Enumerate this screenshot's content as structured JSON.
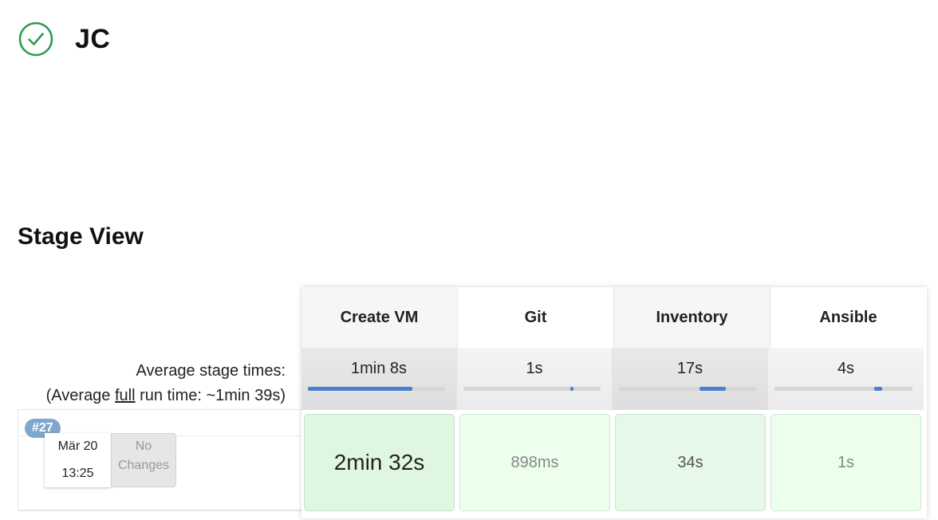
{
  "job": {
    "title": "JC",
    "status_icon": "check-circle-icon",
    "status_color": "#2f9c4d"
  },
  "stage_view": {
    "title": "Stage View",
    "avg_label_line1": "Average stage times:",
    "avg_label_prefix": "(Average ",
    "avg_label_link": "full",
    "avg_label_suffix": " run time: ~1min 39s)",
    "stages": [
      {
        "name": "Create VM",
        "avg": "1min 8s",
        "avg_progress": 0.76
      },
      {
        "name": "Git",
        "avg": "1s",
        "avg_progress": 0.01
      },
      {
        "name": "Inventory",
        "avg": "17s",
        "avg_progress": 0.19
      },
      {
        "name": "Ansible",
        "avg": "4s",
        "avg_progress": 0.06
      }
    ],
    "runs": [
      {
        "build": "#27",
        "date": "Mär 20",
        "time": "13:25",
        "changes": "No Changes",
        "stage_times": [
          "2min 32s",
          "898ms",
          "34s",
          "1s"
        ]
      }
    ]
  }
}
